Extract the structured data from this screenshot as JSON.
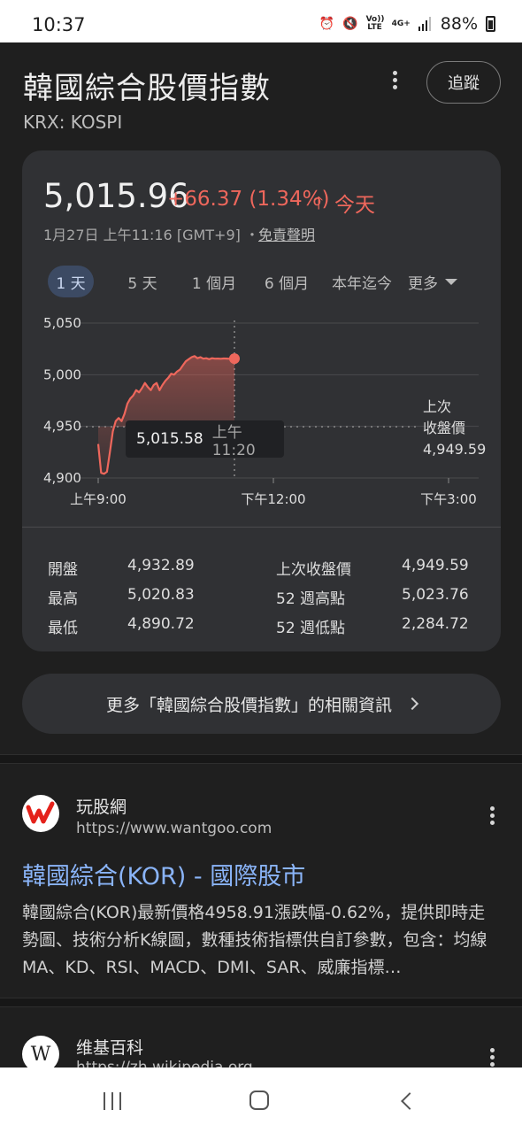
{
  "status_bar": {
    "time": "10:37",
    "battery": "88%",
    "icons": [
      "alarm-icon",
      "mute-icon",
      "volte-icon",
      "4g-plus-icon",
      "signal-icon",
      "battery-icon"
    ],
    "volte_label": "Vo)) LTE",
    "network_label": "4G+"
  },
  "header": {
    "title": "韓國綜合股價指數",
    "exchange": "KRX: KOSPI",
    "follow_label": "追蹤"
  },
  "quote": {
    "price": "5,015.96",
    "change": "+66.37 (1.34%)",
    "period": "今天",
    "timestamp": "1月27日 上午11:16 [GMT+9] ・",
    "disclaimer": "免責聲明",
    "change_color": "#ee675c"
  },
  "range_tabs": {
    "items": [
      "1 天",
      "5 天",
      "1 個月",
      "6 個月",
      "本年迄今"
    ],
    "more_label": "更多",
    "active_index": 0
  },
  "tooltip": {
    "value": "5,015.58",
    "time": "上午11:20"
  },
  "prev_close": {
    "label_line1": "上次",
    "label_line2": "收盤價",
    "value": "4,949.59"
  },
  "chart_data": {
    "type": "line",
    "yticks": [
      "5,050",
      "5,000",
      "4,950",
      "4,900"
    ],
    "ylim": [
      4900,
      5050
    ],
    "xticks": [
      "上午9:00",
      "下午12:00",
      "下午3:00"
    ],
    "xlim_hours": [
      9.0,
      15.5
    ],
    "reference_line": 4949.59,
    "cursor_hour": 11.333,
    "series": [
      {
        "color": "#ee675c",
        "x": [
          9.0,
          9.05,
          9.1,
          9.15,
          9.2,
          9.25,
          9.3,
          9.35,
          9.4,
          9.45,
          9.5,
          9.55,
          9.6,
          9.65,
          9.7,
          9.75,
          9.8,
          9.85,
          9.9,
          9.95,
          10.0,
          10.05,
          10.1,
          10.15,
          10.2,
          10.25,
          10.3,
          10.35,
          10.4,
          10.45,
          10.5,
          10.55,
          10.6,
          10.65,
          10.7,
          10.75,
          10.8,
          10.85,
          10.9,
          10.95,
          11.0,
          11.05,
          11.1,
          11.15,
          11.2,
          11.25,
          11.333
        ],
        "values": [
          4932.89,
          4905,
          4904,
          4906,
          4925,
          4945,
          4955,
          4958,
          4955,
          4962,
          4972,
          4977,
          4980,
          4985,
          4983,
          4987,
          4992,
          4988,
          4985,
          4990,
          4992,
          4985,
          4990,
          4994,
          4997,
          5001,
          5000,
          5003,
          5005,
          5009,
          5013,
          5015,
          5017,
          5018,
          5016,
          5017,
          5015.58,
          5016,
          5015,
          5016,
          5015.58,
          5015.6,
          5015.5,
          5015.7,
          5015.6,
          5015.5,
          5015.58
        ]
      }
    ]
  },
  "stats": {
    "left": [
      {
        "label": "開盤",
        "value": "4,932.89"
      },
      {
        "label": "最高",
        "value": "5,020.83"
      },
      {
        "label": "最低",
        "value": "4,890.72"
      }
    ],
    "right": [
      {
        "label": "上次收盤價",
        "value": "4,949.59"
      },
      {
        "label": "52 週高點",
        "value": "5,023.76"
      },
      {
        "label": "52 週低點",
        "value": "2,284.72"
      }
    ]
  },
  "related": {
    "label": "更多「韓國綜合股價指數」的相關資訊"
  },
  "results": [
    {
      "site": "玩股網",
      "url": "https://www.wantgoo.com",
      "title": "韓國綜合(KOR) - 國際股市",
      "snippet": "韓國綜合(KOR)最新價格4958.91漲跌幅-0.62%，提供即時走勢圖、技術分析K線圖，數種技術指標供自訂參數，包含：均線MA、KD、RSI、MACD、DMI、SAR、威廉指標…",
      "favicon": "wantgoo-logo-icon"
    },
    {
      "site": "维基百科",
      "url": "https://zh.wikipedia.org",
      "favicon_letter": "W"
    }
  ]
}
